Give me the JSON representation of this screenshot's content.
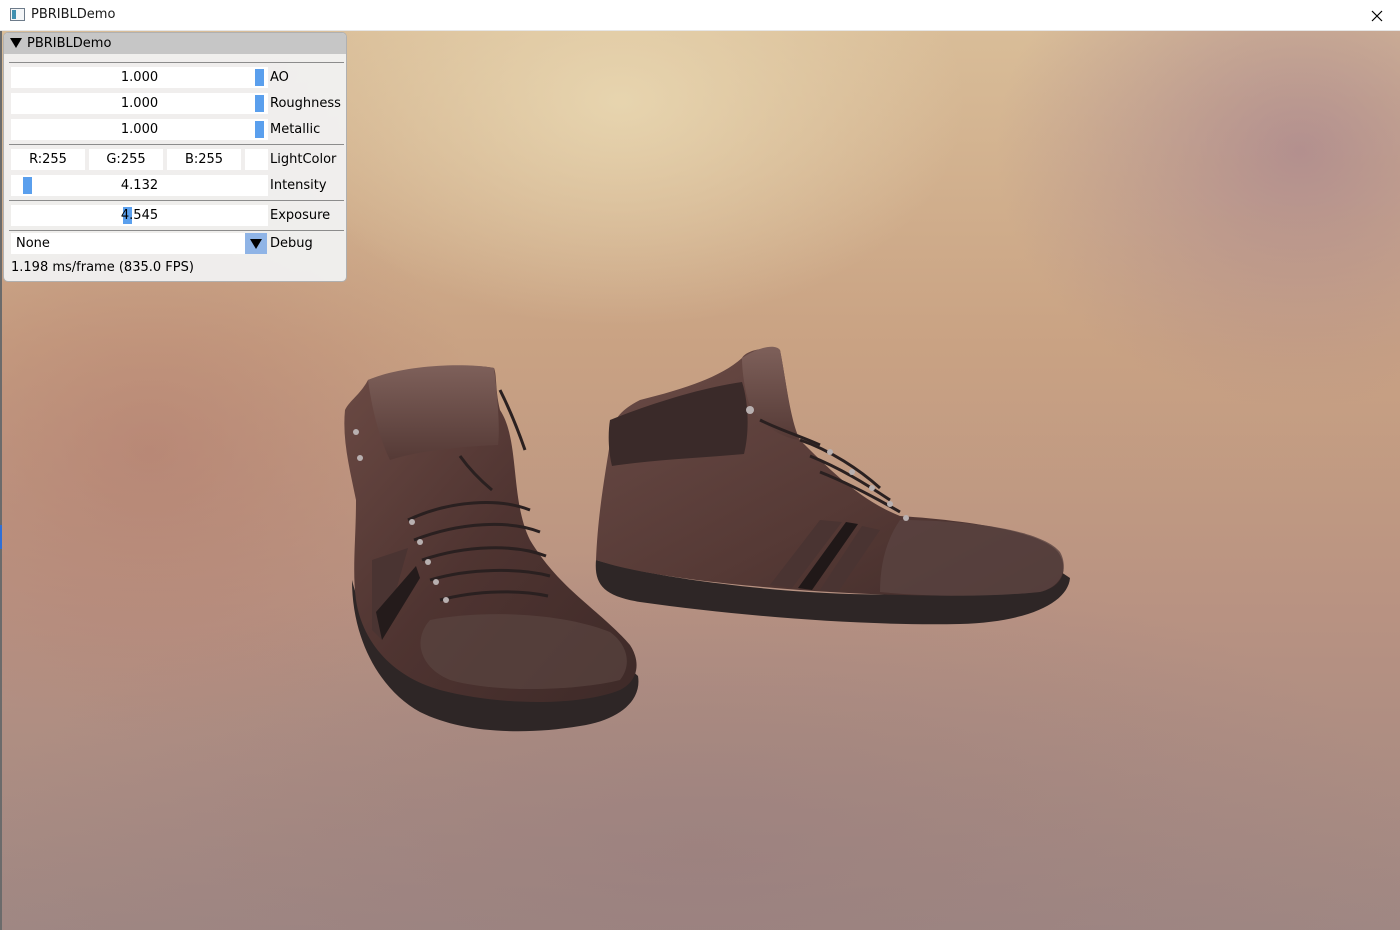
{
  "window": {
    "title": "PBRIBLDemo",
    "close_icon": "close-x"
  },
  "panel": {
    "title": "PBRIBLDemo",
    "ao": {
      "value": "1.000",
      "label": "AO",
      "level": 1.0
    },
    "roughness": {
      "value": "1.000",
      "label": "Roughness",
      "level": 1.0
    },
    "metallic": {
      "value": "1.000",
      "label": "Metallic",
      "level": 1.0
    },
    "light_color": {
      "r": "R:255",
      "g": "G:255",
      "b": "B:255",
      "label": "LightColor"
    },
    "intensity": {
      "value": "4.132",
      "label": "Intensity"
    },
    "exposure": {
      "value": "4.545",
      "label": "Exposure"
    },
    "debug": {
      "value": "None",
      "label": "Debug"
    },
    "stats": "1.198 ms/frame (835.0 FPS)"
  },
  "colors": {
    "accent": "#5a9fed",
    "combo_button": "#8fb4e6",
    "panel_bg": "#f0f0f0",
    "header_bg": "#c6c6c6"
  }
}
